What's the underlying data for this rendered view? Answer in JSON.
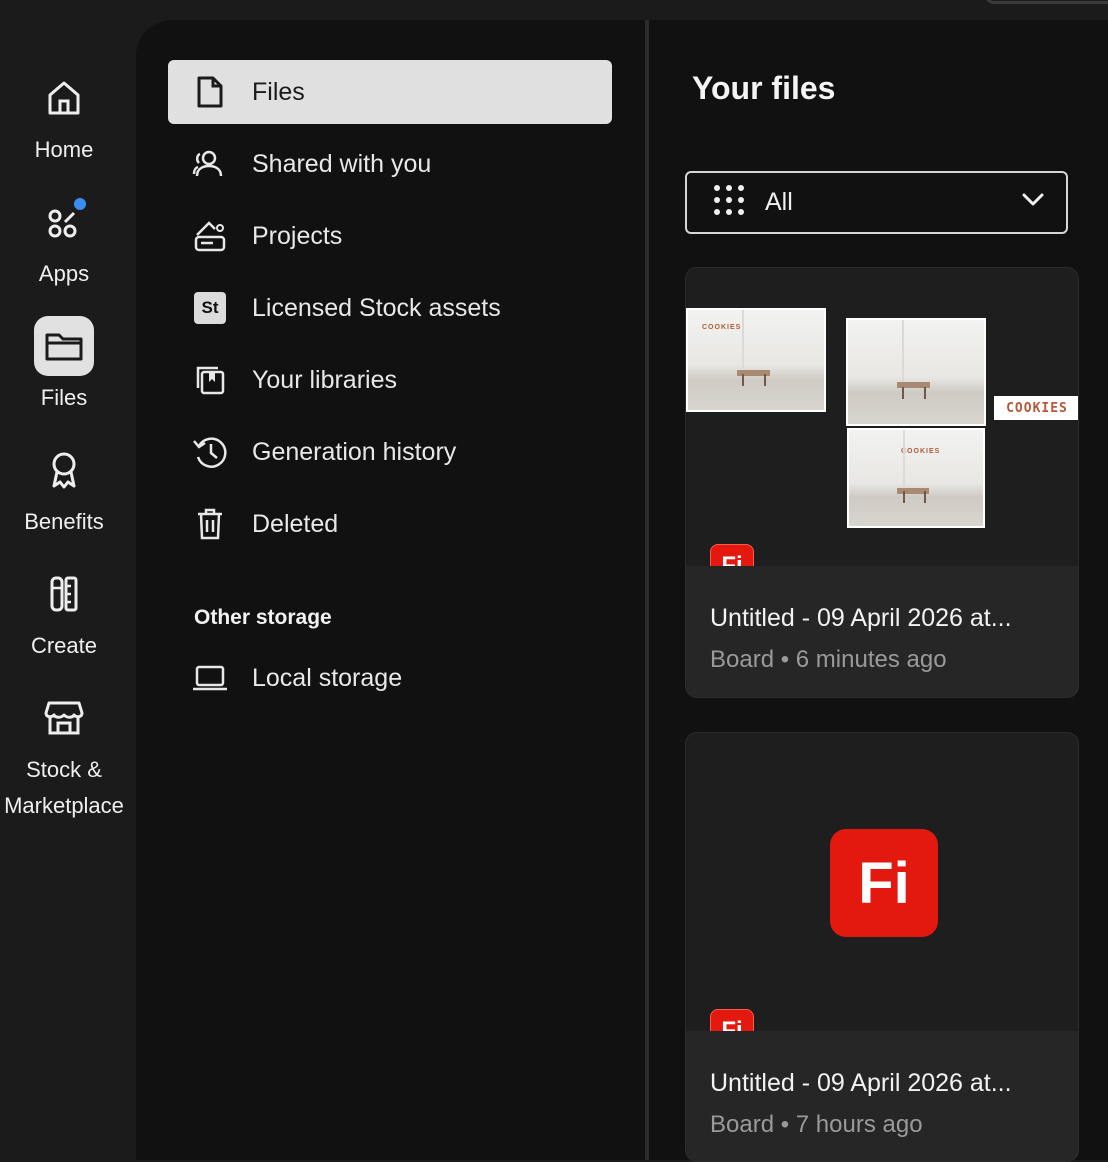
{
  "rail": {
    "items": [
      {
        "label": "Home",
        "icon": "home-icon"
      },
      {
        "label": "Apps",
        "icon": "apps-icon"
      },
      {
        "label": "Files",
        "icon": "folder-icon"
      },
      {
        "label": "Benefits",
        "icon": "ribbon-icon"
      },
      {
        "label": "Create",
        "icon": "create-icon"
      },
      {
        "label": "Stock &",
        "label2": "Marketplace",
        "icon": "store-icon"
      }
    ],
    "active": "Files"
  },
  "nav": {
    "items": [
      {
        "label": "Files",
        "icon": "file-icon"
      },
      {
        "label": "Shared with you",
        "icon": "people-icon"
      },
      {
        "label": "Projects",
        "icon": "projects-icon"
      },
      {
        "label": "Licensed Stock assets",
        "icon": "stock-st-icon",
        "icon_text": "St"
      },
      {
        "label": "Your libraries",
        "icon": "libraries-icon"
      },
      {
        "label": "Generation history",
        "icon": "history-icon"
      },
      {
        "label": "Deleted",
        "icon": "trash-icon"
      }
    ],
    "other_storage_title": "Other storage",
    "other_storage": [
      {
        "label": "Local storage",
        "icon": "laptop-icon"
      }
    ]
  },
  "main": {
    "title": "Your files",
    "filter": {
      "value": "All"
    },
    "cards": [
      {
        "title": "Untitled - 09 April 2026 at...",
        "subtitle": "Board • 6 minutes ago",
        "badge_text": "Fi",
        "thumb_text": "COOKIES"
      },
      {
        "title": "Untitled - 09 April 2026 at...",
        "subtitle": "Board • 7 hours ago",
        "badge_text": "Fi"
      }
    ]
  },
  "colors": {
    "accent_blue": "#3b8cf5",
    "firefly_red": "#e3180f",
    "active_bg": "#e0e0e0"
  }
}
